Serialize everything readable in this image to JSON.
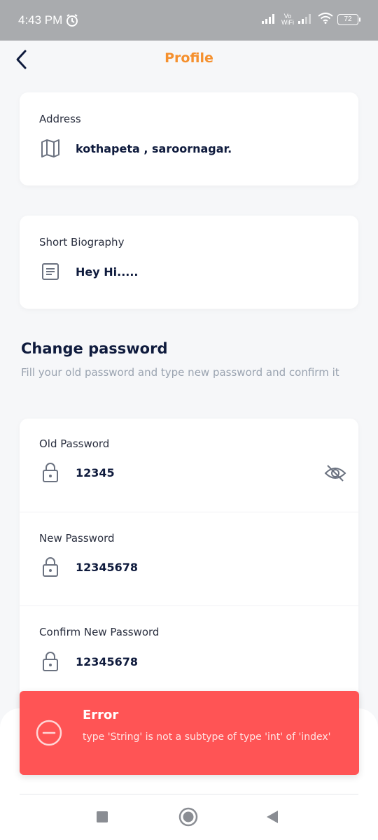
{
  "status_bar": {
    "time": "4:43 PM",
    "network_label_top": "Vo",
    "network_label_bottom": "WiFi",
    "battery": "72"
  },
  "header": {
    "title": "Profile",
    "back_icon": "chevron-left-icon"
  },
  "address": {
    "label": "Address",
    "value": "kothapeta  , saroornagar.",
    "icon": "map-icon"
  },
  "biography": {
    "label": "Short Biography",
    "value": "Hey Hi.....",
    "icon": "document-icon"
  },
  "change_password": {
    "title": "Change password",
    "description": "Fill your old password and type new password and confirm it",
    "fields": [
      {
        "label": "Old Password",
        "value": "12345",
        "icon": "lock-icon",
        "toggle_icon": "eye-off-icon"
      },
      {
        "label": "New Password",
        "value": "12345678",
        "icon": "lock-icon"
      },
      {
        "label": "Confirm New Password",
        "value": "12345678",
        "icon": "lock-icon"
      }
    ]
  },
  "toast": {
    "title": "Error",
    "message": "type 'String' is not a subtype of type 'int' of 'index'",
    "color": "#ff5455",
    "icon": "minus-circle-icon"
  },
  "colors": {
    "accent": "#f5902e",
    "text_primary": "#0f1b3d",
    "background": "#f6f7f9"
  },
  "nav_bar": {
    "icons": [
      "square-recent-icon",
      "circle-home-icon",
      "triangle-back-icon"
    ]
  }
}
